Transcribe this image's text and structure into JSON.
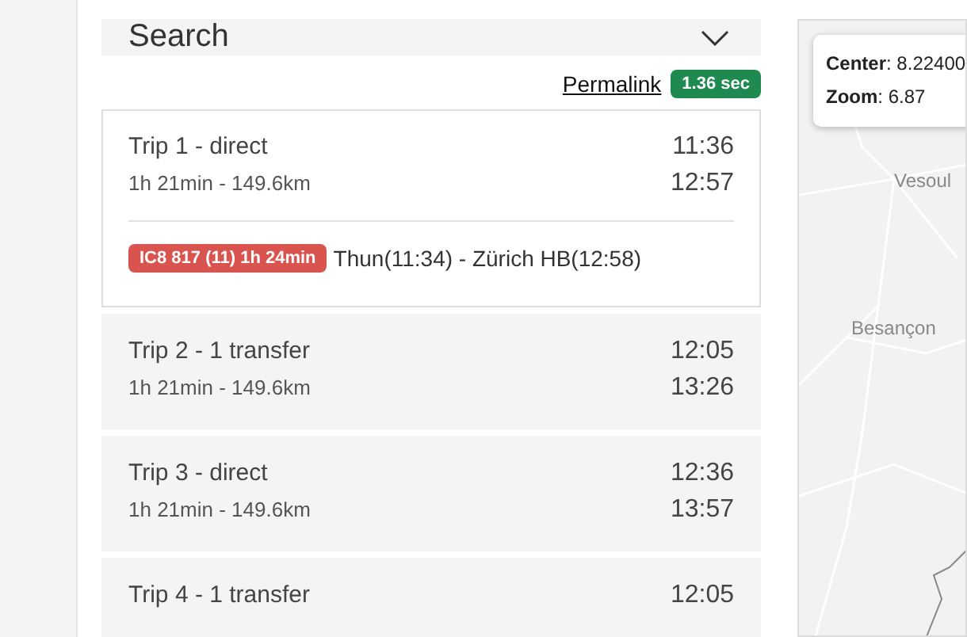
{
  "search": {
    "title": "Search",
    "expanded": false
  },
  "permalink": "Permalink",
  "timing": "1.36 sec",
  "trips": [
    {
      "title": "Trip 1 - direct",
      "summary": "1h 21min - 149.6km",
      "departure": "11:36",
      "arrival": "12:57",
      "expanded": true,
      "legs": [
        {
          "badge": "IC8 817 (11) 1h 24min",
          "color": "#d9534f",
          "route": "Thun(11:34) - Zürich HB(12:58)"
        }
      ]
    },
    {
      "title": "Trip 2 - 1 transfer",
      "summary": "1h 21min - 149.6km",
      "departure": "12:05",
      "arrival": "13:26",
      "expanded": false
    },
    {
      "title": "Trip 3 - direct",
      "summary": "1h 21min - 149.6km",
      "departure": "12:36",
      "arrival": "13:57",
      "expanded": false
    },
    {
      "title": "Trip 4 - 1 transfer",
      "departure": "12:05",
      "expanded": false
    }
  ],
  "map": {
    "info_lines": [
      "**Center**: 8.22400",
      "**Zoom**: 6.87"
    ],
    "places": [
      "Vesoul",
      "Besançon"
    ]
  }
}
